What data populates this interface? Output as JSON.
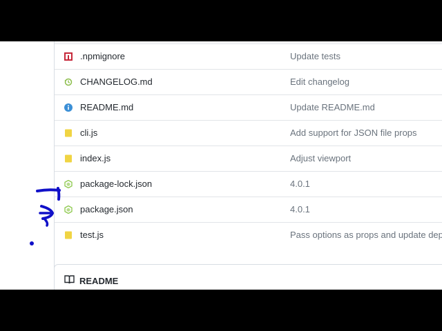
{
  "files": [
    {
      "name": ".npmignore",
      "message": "Update tests",
      "icon": "npm-icon"
    },
    {
      "name": "CHANGELOG.md",
      "message": "Edit changelog",
      "icon": "history-icon"
    },
    {
      "name": "README.md",
      "message": "Update README.md",
      "icon": "info-icon"
    },
    {
      "name": "cli.js",
      "message": "Add support for JSON file props",
      "icon": "js-file-icon"
    },
    {
      "name": "index.js",
      "message": "Adjust viewport",
      "icon": "js-file-icon"
    },
    {
      "name": "package-lock.json",
      "message": "4.0.1",
      "icon": "node-file-icon"
    },
    {
      "name": "package.json",
      "message": "4.0.1",
      "icon": "node-file-icon"
    },
    {
      "name": "test.js",
      "message": "Pass options as props and update depe",
      "icon": "js-file-icon"
    }
  ],
  "readme": {
    "title": "README",
    "icon": "book-icon"
  },
  "colors": {
    "npm": "#c6283a",
    "history": "#8bbd4a",
    "info": "#3b8fd6",
    "js": "#f0d443",
    "node": "#8cc84b",
    "annotation": "#1010c8"
  }
}
